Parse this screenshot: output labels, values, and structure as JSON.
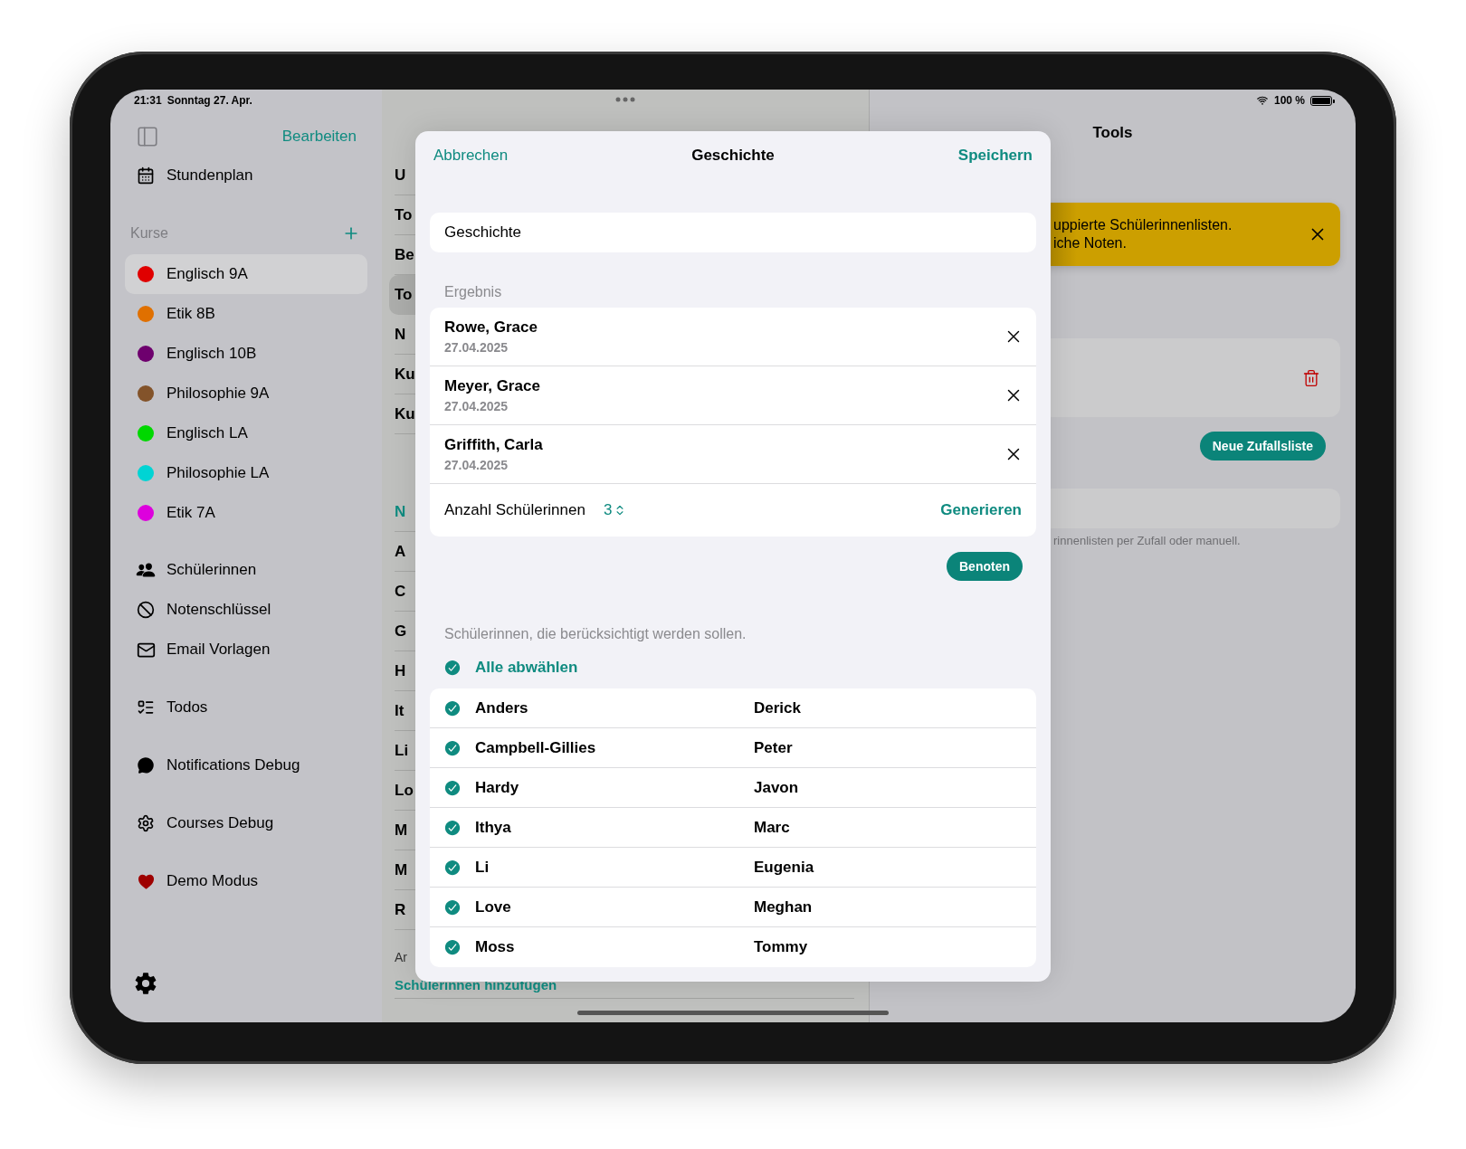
{
  "status_bar": {
    "time": "21:31",
    "date": "Sonntag 27. Apr.",
    "battery": "100 %"
  },
  "sidebar": {
    "edit": "Bearbeiten",
    "top_items": [
      {
        "label": "Stundenplan",
        "kind": "calendar"
      }
    ],
    "courses_title": "Kurse",
    "courses": [
      {
        "label": "Englisch 9A",
        "color": "#e00000",
        "selected": true
      },
      {
        "label": "Etik 8B",
        "color": "#e07000",
        "selected": false
      },
      {
        "label": "Englisch 10B",
        "color": "#6e006e",
        "selected": false
      },
      {
        "label": "Philosophie 9A",
        "color": "#83532a",
        "selected": false
      },
      {
        "label": "Englisch LA",
        "color": "#00d800",
        "selected": false
      },
      {
        "label": "Philosophie LA",
        "color": "#00d4d4",
        "selected": false
      },
      {
        "label": "Etik 7A",
        "color": "#dd00dd",
        "selected": false
      }
    ],
    "mid_items": [
      {
        "label": "Schülerinnen",
        "kind": "people"
      },
      {
        "label": "Notenschlüssel",
        "kind": "slash"
      },
      {
        "label": "Email Vorlagen",
        "kind": "mail"
      }
    ],
    "debug_items": [
      {
        "label": "Todos",
        "kind": "todo"
      },
      {
        "label": "Notifications Debug",
        "kind": "bubble"
      },
      {
        "label": "Courses Debug",
        "kind": "gear"
      },
      {
        "label": "Demo Modus",
        "kind": "heart"
      }
    ]
  },
  "middle": {
    "top_rows": [
      {
        "text": "U",
        "selected": false
      },
      {
        "text": "To",
        "selected": false
      },
      {
        "text": "Be",
        "selected": false
      },
      {
        "text": "To",
        "selected": true
      },
      {
        "text": "N",
        "selected": false
      },
      {
        "text": "Ku",
        "selected": false
      },
      {
        "text": "Ku",
        "selected": false
      }
    ],
    "section_header": "N",
    "student_rows": [
      "A",
      "C",
      "G",
      "H",
      "It",
      "Li",
      "Lo",
      "M",
      "M",
      "R"
    ],
    "footer_label": "Ar",
    "add_link": "Schülerinnen hinzufügen"
  },
  "tools": {
    "title": "Tools",
    "banner": [
      "uppierte Schülerinnenlisten.",
      "iche Noten."
    ],
    "new_list": "Neue Zufallsliste",
    "footnote": "rinnenlisten per Zufall oder manuell."
  },
  "modal": {
    "cancel": "Abbrechen",
    "title": "Geschichte",
    "save": "Speichern",
    "name_value": "Geschichte",
    "result_header": "Ergebnis",
    "results": [
      {
        "name": "Rowe, Grace",
        "date": "27.04.2025"
      },
      {
        "name": "Meyer, Grace",
        "date": "27.04.2025"
      },
      {
        "name": "Griffith, Carla",
        "date": "27.04.2025"
      }
    ],
    "count_label": "Anzahl Schülerinnen",
    "count_value": "3",
    "generate": "Generieren",
    "grade": "Benoten",
    "students_note": "Schülerinnen, die berücksichtigt werden sollen.",
    "deselect_all": "Alle abwählen",
    "students": [
      {
        "last": "Anders",
        "first": "Derick",
        "checked": true
      },
      {
        "last": "Campbell-Gillies",
        "first": "Peter",
        "checked": true
      },
      {
        "last": "Hardy",
        "first": "Javon",
        "checked": true
      },
      {
        "last": "Ithya",
        "first": "Marc",
        "checked": true
      },
      {
        "last": "Li",
        "first": "Eugenia",
        "checked": true
      },
      {
        "last": "Love",
        "first": "Meghan",
        "checked": true
      },
      {
        "last": "Moss",
        "first": "Tommy",
        "checked": true
      }
    ]
  }
}
